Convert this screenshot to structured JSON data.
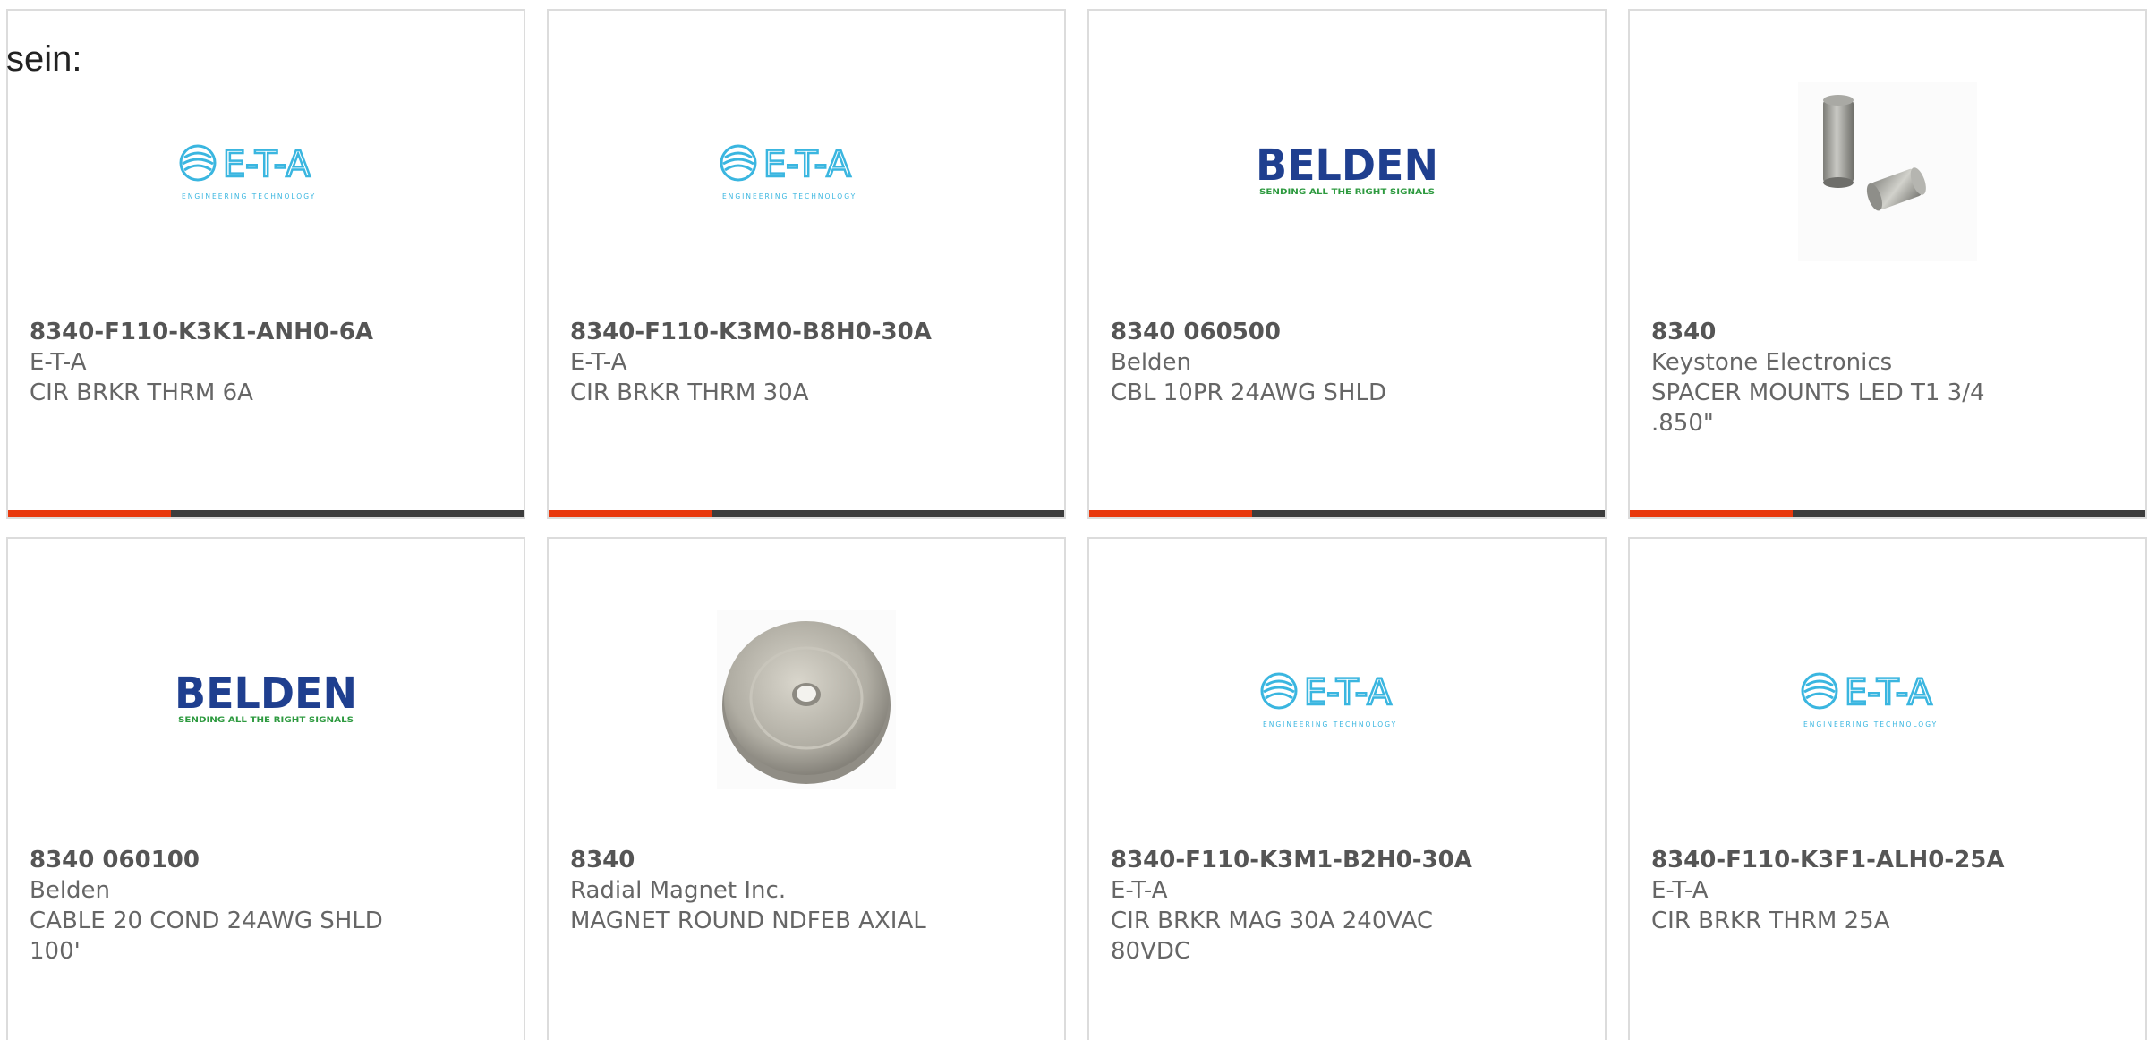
{
  "intro": {
    "text": "sein:"
  },
  "accent_color": "#e8380d",
  "bar_color": "#3c3c3c",
  "products": [
    {
      "image": "eta-logo",
      "part": "8340-F110-K3K1-ANH0-6A",
      "manufacturer": "E-T-A",
      "description": "CIR BRKR THRM 6A"
    },
    {
      "image": "eta-logo",
      "part": "8340-F110-K3M0-B8H0-30A",
      "manufacturer": "E-T-A",
      "description": "CIR BRKR THRM 30A"
    },
    {
      "image": "belden-logo",
      "part": "8340 060500",
      "manufacturer": "Belden",
      "description": "CBL 10PR 24AWG SHLD"
    },
    {
      "image": "spacer-photo",
      "part": "8340",
      "manufacturer": "Keystone Electronics",
      "description": "SPACER MOUNTS LED T1 3/4 .850\""
    },
    {
      "image": "belden-logo",
      "part": "8340 060100",
      "manufacturer": "Belden",
      "description": "CABLE 20 COND 24AWG SHLD 100'"
    },
    {
      "image": "magnet-photo",
      "part": "8340",
      "manufacturer": "Radial Magnet Inc.",
      "description": "MAGNET ROUND NDFEB AXIAL"
    },
    {
      "image": "eta-logo",
      "part": "8340-F110-K3M1-B2H0-30A",
      "manufacturer": "E-T-A",
      "description": "CIR BRKR MAG 30A 240VAC 80VDC"
    },
    {
      "image": "eta-logo",
      "part": "8340-F110-K3F1-ALH0-25A",
      "manufacturer": "E-T-A",
      "description": "CIR BRKR THRM 25A"
    }
  ],
  "logos": {
    "eta": {
      "mark": "E-T-A",
      "tagline": "ENGINEERING TECHNOLOGY",
      "color": "#3ab6e0"
    },
    "belden": {
      "mark": "BELDEN",
      "tagline": "SENDING ALL THE RIGHT SIGNALS",
      "color": "#1f3f8f",
      "tagline_color": "#2d9a3f"
    }
  }
}
